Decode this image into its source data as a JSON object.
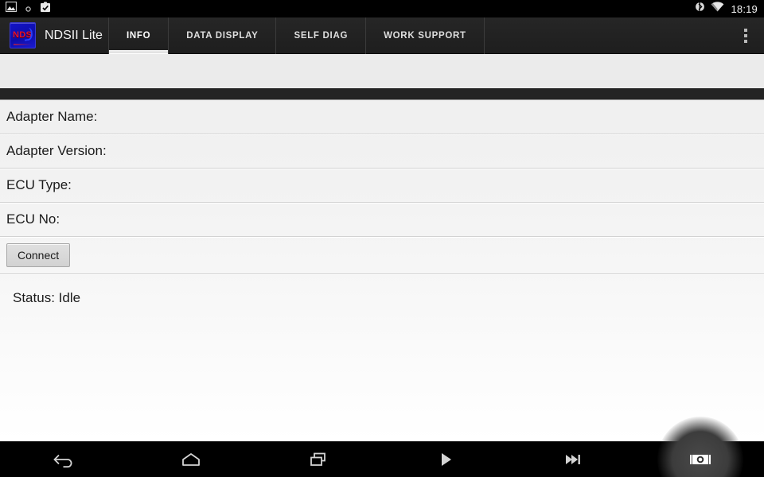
{
  "status_bar": {
    "icons_left": [
      "screenshot-image-icon",
      "dot-icon",
      "clipboard-check-icon"
    ],
    "icons_right": [
      "bluetooth-icon",
      "wifi-icon"
    ],
    "time": "18:19"
  },
  "action_bar": {
    "logo_text": "NDS",
    "app_title": "NDSII Lite",
    "overflow_icon": "overflow-menu-icon",
    "tabs": [
      {
        "label": "INFO",
        "selected": true
      },
      {
        "label": "DATA DISPLAY",
        "selected": false
      },
      {
        "label": "SELF DIAG",
        "selected": false
      },
      {
        "label": "WORK SUPPORT",
        "selected": false
      }
    ]
  },
  "main": {
    "rows": [
      {
        "label": "Adapter Name:",
        "value": ""
      },
      {
        "label": "Adapter Version:",
        "value": ""
      },
      {
        "label": "ECU Type:",
        "value": ""
      },
      {
        "label": "ECU No:",
        "value": ""
      }
    ],
    "connect_button": "Connect",
    "status_text": "Status: Idle"
  },
  "nav_bar": {
    "buttons": [
      {
        "name": "back-icon",
        "pressed": false
      },
      {
        "name": "home-icon",
        "pressed": false
      },
      {
        "name": "recents-icon",
        "pressed": false
      },
      {
        "name": "play-icon",
        "pressed": false
      },
      {
        "name": "skip-forward-icon",
        "pressed": false
      },
      {
        "name": "camera-screenshot-icon",
        "pressed": true
      }
    ]
  },
  "colors": {
    "status_bar_bg": "#000000",
    "action_bar_bg": "#1f1f1f",
    "content_bg": "#f2f2f2",
    "dark_strip": "#242424",
    "logo_blue": "#1414c8",
    "logo_red": "#e01030",
    "nav_bar_bg": "#000000"
  }
}
